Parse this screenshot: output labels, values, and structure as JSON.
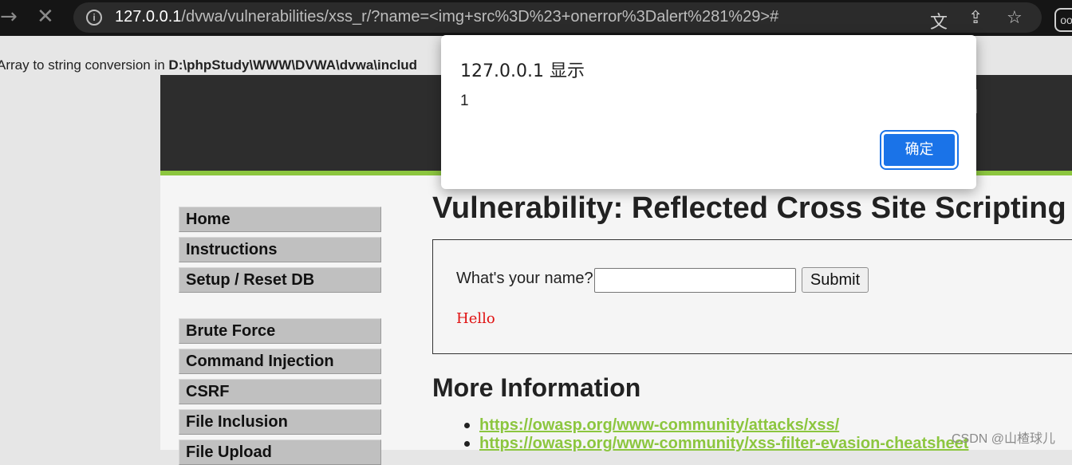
{
  "browser": {
    "url_host": "127.0.0.1",
    "url_rest": "/dvwa/vulnerabilities/xss_r/?name=<img+src%3D%23+onerror%3Dalert%281%29>#",
    "icons": [
      "arrow-forward-icon",
      "stop-loading-icon",
      "site-info-icon",
      "translate-icon",
      "share-icon",
      "bookmark-star-icon",
      "profile-icon"
    ]
  },
  "notice": {
    "text": "Array to string conversion in ",
    "path": "D:\\phpStudy\\WWW\\DVWA\\dvwa\\includ"
  },
  "sidebar": {
    "items": [
      {
        "label": "Home"
      },
      {
        "label": "Instructions"
      },
      {
        "label": "Setup / Reset DB"
      },
      {
        "label": "Brute Force"
      },
      {
        "label": "Command Injection"
      },
      {
        "label": "CSRF"
      },
      {
        "label": "File Inclusion"
      },
      {
        "label": "File Upload"
      }
    ]
  },
  "main": {
    "title": "Vulnerability: Reflected Cross Site Scripting",
    "form": {
      "label": "What's your name?",
      "input_value": "",
      "submit_label": "Submit"
    },
    "output": "Hello",
    "more_title": "More Information",
    "links": [
      "https://owasp.org/www-community/attacks/xss/",
      "https://owasp.org/www-community/xss-filter-evasion-cheatsheet"
    ]
  },
  "dialog": {
    "title": "127.0.0.1 显示",
    "message": "1",
    "ok_label": "确定"
  },
  "watermark": "CSDN @山楂球儿",
  "colors": {
    "accent": "#8cc63f",
    "header_bg": "#2d2d2d",
    "dialog_button": "#1a73e8",
    "output_text": "#e01010"
  }
}
